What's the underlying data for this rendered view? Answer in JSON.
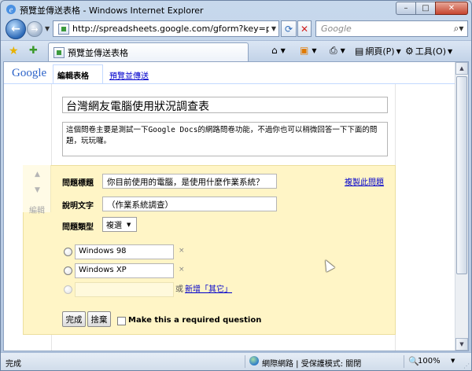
{
  "window": {
    "title": "預覽並傳送表格 - Windows Internet Explorer",
    "minimize": "–",
    "maximize": "□",
    "close": "✕"
  },
  "addressbar": {
    "url": "http://spreadsheets.google.com/gform?key=pytbFzE",
    "search_placeholder": "Google"
  },
  "tabrow": {
    "tab_title": "預覽並傳送表格",
    "page_menu": "網頁(P)",
    "tools_menu": "工具(O)"
  },
  "google": {
    "logo": "Google",
    "tab_edit": "編輯表格",
    "tab_preview": "預覽並傳送"
  },
  "form": {
    "title": "台灣網友電腦使用狀況調查表",
    "description": "這個問卷主要是測試一下Google Docs的網路問卷功能，不過你也可以稍微回答一下下面的問題，玩玩囉。"
  },
  "question": {
    "edit_label": "編輯",
    "title_label": "問題標題",
    "title_value": "你目前使用的電腦，是使用什麼作業系統？",
    "copy_link": "複製此問題",
    "help_label": "說明文字",
    "help_value": "（作業系統調查）",
    "type_label": "問題類型",
    "type_value": "複選",
    "options": [
      {
        "text": "Windows 98",
        "remove": "×"
      },
      {
        "text": "Windows XP",
        "remove": "×"
      }
    ],
    "or_text": "或",
    "add_other": "新增「其它」",
    "done_button": "完成",
    "discard_button": "捨棄",
    "required_label": "Make this a required question"
  },
  "statusbar": {
    "status": "完成",
    "zone": "網際網路 | 受保護模式: 關閉",
    "zoom": "100%"
  },
  "colors": {
    "accent": "#3a6bc9",
    "question_bg": "#fff5c6",
    "link": "#0000cc"
  }
}
